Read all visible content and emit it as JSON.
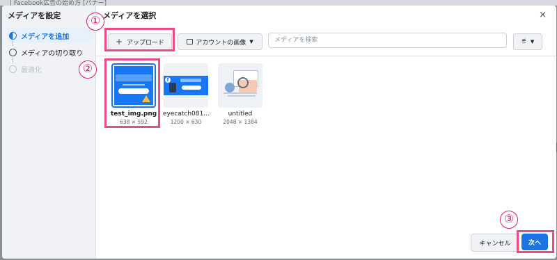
{
  "background": {
    "top_text": "| Facebook広告の始め方 [バナー]"
  },
  "sidebar": {
    "title": "メディアを設定",
    "steps": [
      {
        "label": "メディアを追加",
        "state": "active"
      },
      {
        "label": "メディアの切り取り",
        "state": "pending"
      },
      {
        "label": "最適化",
        "state": "disabled"
      }
    ]
  },
  "main": {
    "title": "メディアを選択",
    "close_icon": "×",
    "upload_label": "アップロード",
    "upload_icon": "+",
    "account_images_label": "アカウントの画像",
    "dropdown_icon": "▼",
    "search_placeholder": "メディアを検索",
    "filter_icon": "⚟",
    "media": [
      {
        "name": "test_img.png",
        "dims": "638 × 592",
        "selected": true
      },
      {
        "name": "eyecatch081...",
        "dims": "1200 × 630",
        "selected": false
      },
      {
        "name": "untitled",
        "dims": "2048 × 1384",
        "selected": false
      }
    ]
  },
  "footer": {
    "cancel_label": "キャンセル",
    "next_label": "次へ"
  },
  "annotations": {
    "n1": "①",
    "n2": "②",
    "n3": "③"
  },
  "colors": {
    "accent": "#1b74e4",
    "highlight": "#ea4b82",
    "annotation_text": "#e31b6b"
  }
}
